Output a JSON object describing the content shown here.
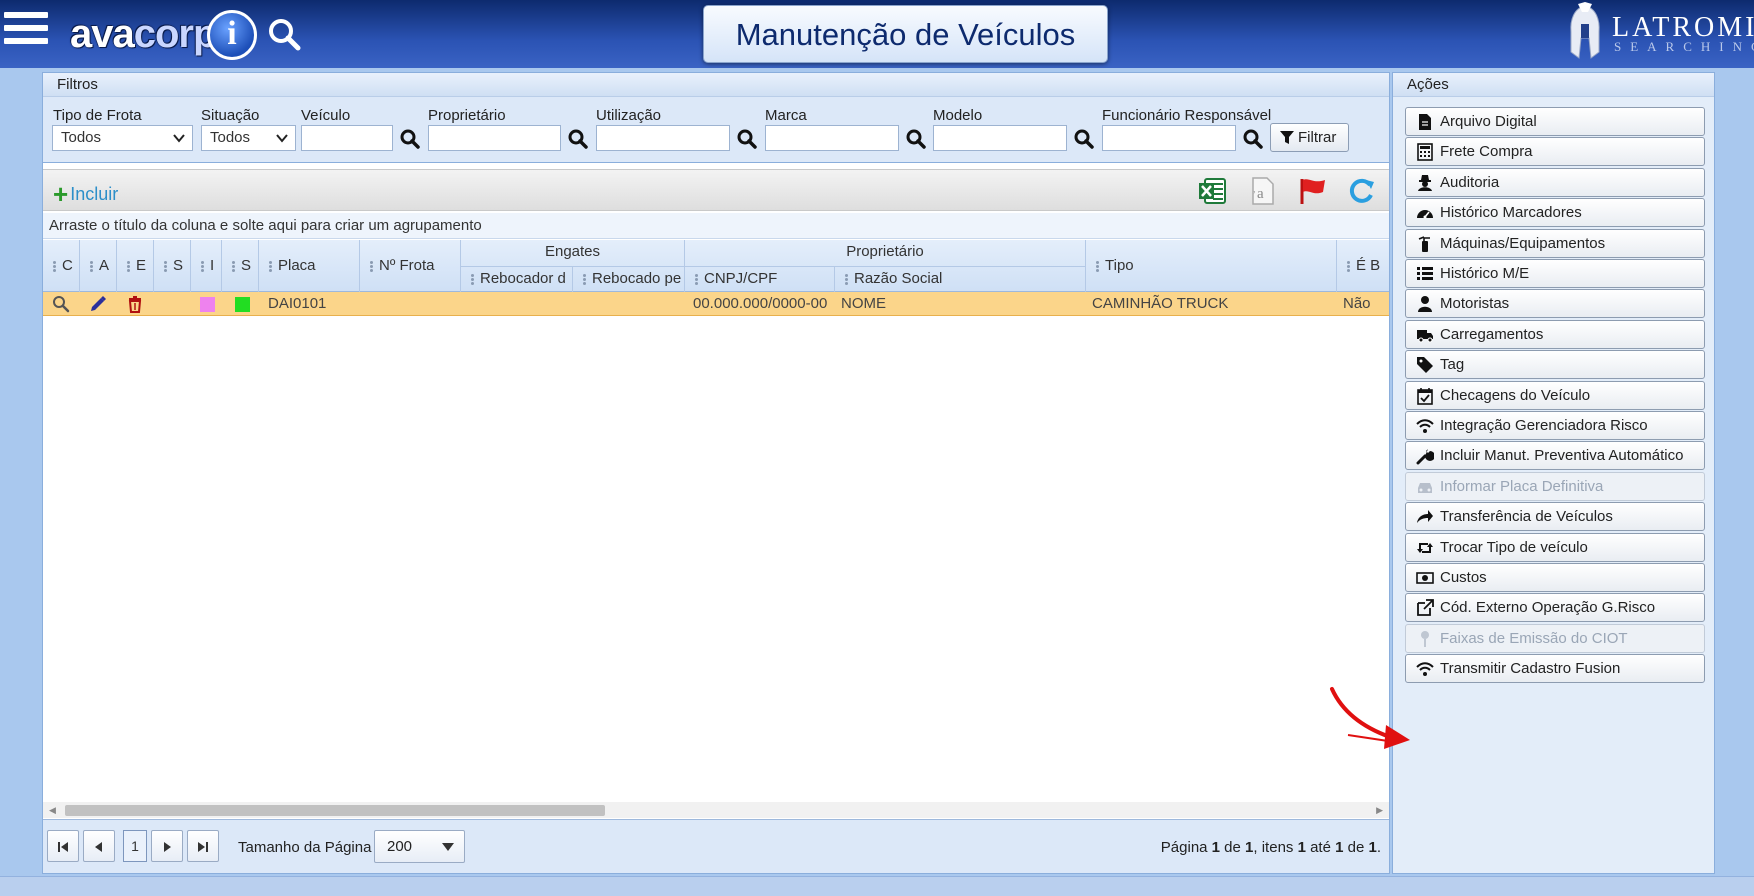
{
  "header": {
    "logo_text_a": "ava",
    "logo_text_b": "corp",
    "logo_mark": "i",
    "title": "Manutenção de Veículos",
    "brand_name": "LATROMI",
    "brand_sub": "SEARCHING"
  },
  "filters": {
    "title": "Filtros",
    "fields": {
      "tipo_frota": {
        "label": "Tipo de Frota",
        "value": "Todos"
      },
      "situacao": {
        "label": "Situação",
        "value": "Todos"
      },
      "veiculo": {
        "label": "Veículo",
        "value": ""
      },
      "proprietario": {
        "label": "Proprietário",
        "value": ""
      },
      "utilizacao": {
        "label": "Utilização",
        "value": ""
      },
      "marca": {
        "label": "Marca",
        "value": ""
      },
      "modelo": {
        "label": "Modelo",
        "value": ""
      },
      "funcionario": {
        "label": "Funcionário Responsável",
        "value": ""
      }
    },
    "filter_button": "Filtrar"
  },
  "toolbar": {
    "include_label": "Incluir"
  },
  "grid": {
    "group_hint": "Arraste o título da coluna e solte aqui para criar um agrupamento",
    "columns": {
      "c": "C",
      "a": "A",
      "e": "E",
      "s1": "S",
      "i": "I",
      "s2": "S",
      "placa": "Placa",
      "frota": "Nº Frota",
      "engates": "Engates",
      "rebocador": "Rebocador d",
      "rebocado": "Rebocado pe",
      "proprietario": "Proprietário",
      "cnpj": "CNPJ/CPF",
      "razao": "Razão Social",
      "tipo": "Tipo",
      "eb": "É B"
    },
    "rows": [
      {
        "swatch1": "#ee82ee",
        "swatch2": "#22dd22",
        "placa": "DAI0101",
        "cnpj": "00.000.000/0000-00",
        "razao": "NOME",
        "tipo": "CAMINHÃO TRUCK",
        "eb": "Não"
      }
    ]
  },
  "pager": {
    "current_page": "1",
    "size_label": "Tamanho da Página",
    "size_value": "200",
    "info_pre": "Página ",
    "info_page": "1",
    "info_of": " de ",
    "info_total_pages": "1",
    "info_items": ", itens ",
    "info_from": "1",
    "info_to_word": " até ",
    "info_to": "1",
    "info_of2": " de ",
    "info_total": "1",
    "info_end": "."
  },
  "actions": {
    "title": "Ações",
    "items": [
      {
        "label": "Arquivo Digital",
        "icon": "file-icon",
        "disabled": false
      },
      {
        "label": "Frete Compra",
        "icon": "calculator-icon",
        "disabled": false
      },
      {
        "label": "Auditoria",
        "icon": "user-secret-icon",
        "disabled": false
      },
      {
        "label": "Histórico Marcadores",
        "icon": "dashboard-icon",
        "disabled": false
      },
      {
        "label": "Máquinas/Equipamentos",
        "icon": "fire-extinguisher-icon",
        "disabled": false
      },
      {
        "label": "Histórico M/E",
        "icon": "list-icon",
        "disabled": false
      },
      {
        "label": "Motoristas",
        "icon": "user-icon",
        "disabled": false
      },
      {
        "label": "Carregamentos",
        "icon": "truck-icon",
        "disabled": false
      },
      {
        "label": "Tag",
        "icon": "tag-icon",
        "disabled": false
      },
      {
        "label": "Checagens do Veículo",
        "icon": "calendar-check-icon",
        "disabled": false
      },
      {
        "label": "Integração Gerenciadora Risco",
        "icon": "wifi-icon",
        "disabled": false
      },
      {
        "label": "Incluir Manut. Preventiva Automático",
        "icon": "wrench-icon",
        "disabled": false
      },
      {
        "label": "Informar Placa Definitiva",
        "icon": "car-icon",
        "disabled": true
      },
      {
        "label": "Transferência de Veículos",
        "icon": "share-icon",
        "disabled": false
      },
      {
        "label": "Trocar Tipo de veículo",
        "icon": "retweet-icon",
        "disabled": false
      },
      {
        "label": "Custos",
        "icon": "money-icon",
        "disabled": false
      },
      {
        "label": "Cód. Externo Operação G.Risco",
        "icon": "external-link-icon",
        "disabled": false
      },
      {
        "label": "Faixas de Emissão do CIOT",
        "icon": "map-pin-icon",
        "disabled": true
      },
      {
        "label": "Transmitir Cadastro Fusion",
        "icon": "wifi-icon",
        "disabled": false
      }
    ]
  },
  "colors": {
    "header_dark": "#0d2a6e",
    "row_highlight": "#fbd58a",
    "annotation_arrow": "#e01010"
  }
}
